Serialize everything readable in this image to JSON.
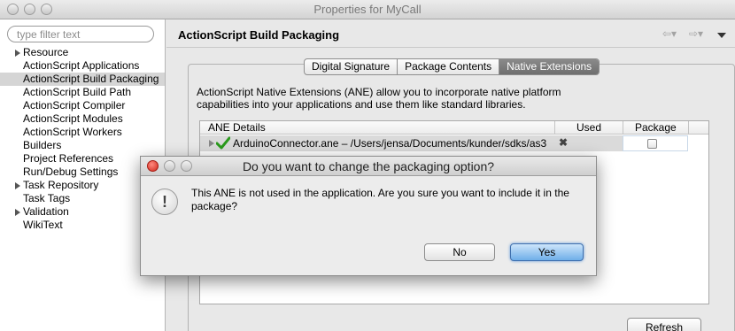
{
  "window": {
    "title": "Properties for MyCall"
  },
  "filter": {
    "placeholder": "type filter text",
    "value": ""
  },
  "tree": {
    "items": [
      {
        "label": "Resource",
        "expandable": true
      },
      {
        "label": "ActionScript Applications",
        "expandable": false
      },
      {
        "label": "ActionScript Build Packaging",
        "expandable": false,
        "selected": true
      },
      {
        "label": "ActionScript Build Path",
        "expandable": false
      },
      {
        "label": "ActionScript Compiler",
        "expandable": false
      },
      {
        "label": "ActionScript Modules",
        "expandable": false
      },
      {
        "label": "ActionScript Workers",
        "expandable": false
      },
      {
        "label": "Builders",
        "expandable": false
      },
      {
        "label": "Project References",
        "expandable": false
      },
      {
        "label": "Run/Debug Settings",
        "expandable": false
      },
      {
        "label": "Task Repository",
        "expandable": true
      },
      {
        "label": "Task Tags",
        "expandable": false
      },
      {
        "label": "Validation",
        "expandable": true
      },
      {
        "label": "WikiText",
        "expandable": false
      }
    ]
  },
  "page": {
    "title": "ActionScript Build Packaging",
    "nav_icons": [
      "back-arrow-icon",
      "forward-arrow-icon",
      "view-menu-icon"
    ]
  },
  "tabs": [
    {
      "label": "Digital Signature",
      "active": false
    },
    {
      "label": "Package Contents",
      "active": false
    },
    {
      "label": "Native Extensions",
      "active": true
    }
  ],
  "description": "ActionScript Native Extensions (ANE) allow you to incorporate native platform capabilities into your applications and use them like standard libraries.",
  "table": {
    "headers": {
      "details": "ANE Details",
      "used": "Used",
      "package": "Package"
    },
    "rows": [
      {
        "name": "ArduinoConnector.ane – /Users/jensa/Documents/kunder/sdks/as3",
        "used_icon": "x-mark-icon",
        "used_mark": "✖",
        "package_checked": false,
        "status_icon": "green-check-icon"
      }
    ]
  },
  "refresh_label": "Refresh",
  "dialog": {
    "title": "Do you want to change the packaging option?",
    "message": "This ANE is not used in the application. Are you sure you want to include it in the package?",
    "icon": "!",
    "no_label": "No",
    "yes_label": "Yes"
  },
  "colors": {
    "default_button": "#6faee9",
    "close_button": "#d0281c",
    "check_green": "#2a9a1c"
  }
}
